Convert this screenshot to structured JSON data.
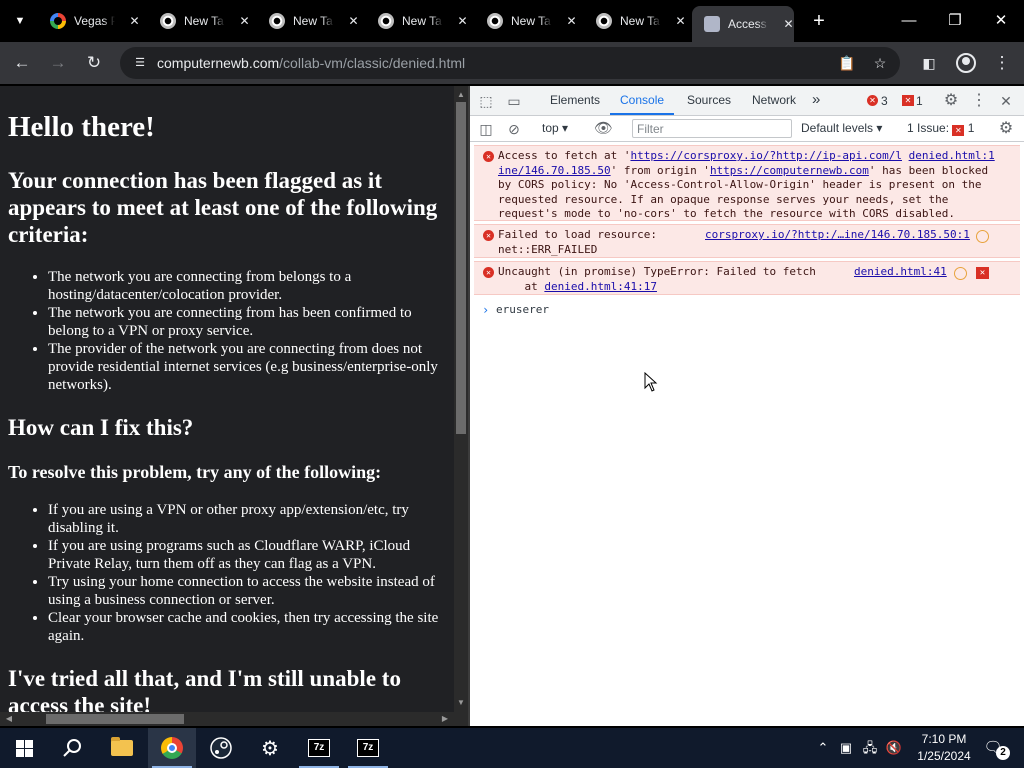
{
  "tabs": [
    {
      "title": "Vegas P",
      "icon": "google-icon",
      "active": false
    },
    {
      "title": "New Ta",
      "icon": "chrome-icon",
      "active": false
    },
    {
      "title": "New Ta",
      "icon": "chrome-icon",
      "active": false
    },
    {
      "title": "New Ta",
      "icon": "chrome-icon",
      "active": false
    },
    {
      "title": "New Ta",
      "icon": "chrome-icon",
      "active": false
    },
    {
      "title": "New Ta",
      "icon": "chrome-icon",
      "active": false
    },
    {
      "title": "Access",
      "icon": "collabvm-icon",
      "active": true
    }
  ],
  "address_bar": {
    "host": "computernewb.com",
    "path": "/collab-vm/classic/denied.html"
  },
  "page": {
    "h1": "Hello there!",
    "h2_flagged": "Your connection has been flagged as it appears to meet at least one of the following criteria:",
    "criteria": [
      "The network you are connecting from belongs to a hosting/datacenter/colocation provider.",
      "The network you are connecting from has been confirmed to belong to a VPN or proxy service.",
      "The provider of the network you are connecting from does not provide residential internet services (e.g business/enterprise-only networks)."
    ],
    "h2_fix": "How can I fix this?",
    "h3_resolve": "To resolve this problem, try any of the following:",
    "fixes": [
      "If you are using a VPN or other proxy app/extension/etc, try disabling it.",
      "If you are using programs such as Cloudflare WARP, iCloud Private Relay, turn them off as they can flag as a VPN.",
      "Try using your home connection to access the website instead of using a business connection or server.",
      "Clear your browser cache and cookies, then try accessing the site again."
    ],
    "h2_still": "I've tried all that, and I'm still unable to access the site!"
  },
  "devtools": {
    "tabs": [
      "Elements",
      "Console",
      "Sources",
      "Network"
    ],
    "active_tab": "Console",
    "overflow": "»",
    "error_count": "3",
    "issue_count": "1",
    "context": "top",
    "filter_placeholder": "Filter",
    "levels": "Default levels",
    "issues_label": "1 Issue:",
    "issues_badge": "1",
    "messages": [
      {
        "prefix": "Access to fetch at '",
        "link1": "https://corsproxy.io/?http://ip-api.com/l",
        "src": "denied.html:1",
        "link1b": "ine/146.70.185.50",
        "mid": "' from origin '",
        "link2": "https://computernewb.com",
        "rest": "' has been blocked by CORS policy: No 'Access-Control-Allow-Origin' header is present on the requested resource. If an opaque response serves your needs, set the request's mode to 'no-cors' to fetch the resource with CORS disabled."
      },
      {
        "text": "Failed to load resource:\nnet::ERR_FAILED",
        "src": "corsproxy.io/?http:/…ine/146.70.185.50:1"
      },
      {
        "text": "Uncaught (in promise) TypeError: Failed to fetch",
        "at": "    at ",
        "at_link": "denied.html:41:17",
        "src": "denied.html:41"
      }
    ],
    "console_input": "eruserer"
  },
  "taskbar": {
    "time": "7:10 PM",
    "date": "1/25/2024",
    "notifications": "2",
    "apps": [
      "start",
      "search",
      "file-explorer",
      "chrome",
      "steam",
      "settings",
      "7zip",
      "7zip"
    ]
  }
}
